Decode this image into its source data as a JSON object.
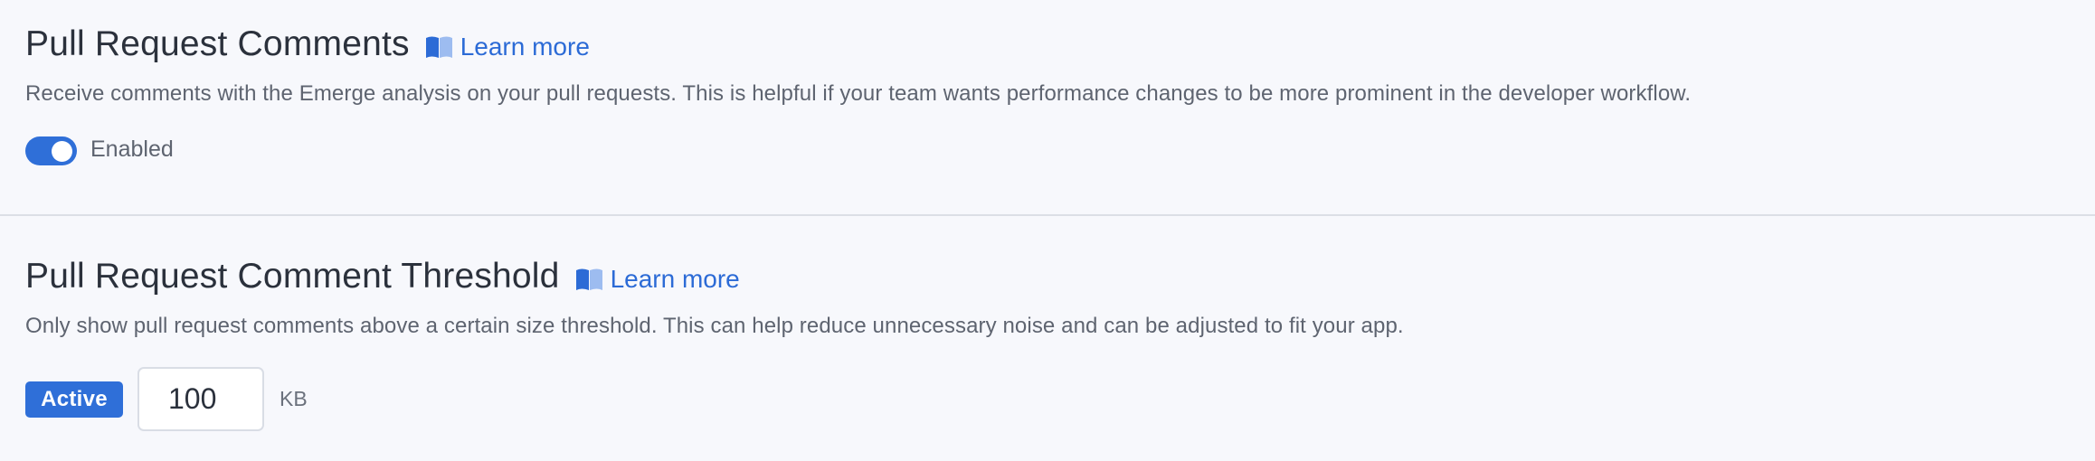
{
  "sections": [
    {
      "title": "Pull Request Comments",
      "learn_more": "Learn more",
      "description": "Receive comments with the Emerge analysis on your pull requests. This is helpful if your team wants performance changes to be more prominent in the developer workflow.",
      "toggle": {
        "label": "Enabled",
        "on": true
      }
    },
    {
      "title": "Pull Request Comment Threshold",
      "learn_more": "Learn more",
      "description": "Only show pull request comments above a certain size threshold. This can help reduce unnecessary noise and can be adjusted to fit your app.",
      "badge": "Active",
      "threshold_value": "100",
      "unit": "KB"
    }
  ],
  "icons": {
    "learn_more": "book-icon"
  },
  "colors": {
    "accent": "#2f6fd8",
    "link": "#2c6bd6",
    "background": "#f7f8fc",
    "divider": "#dcdfe6"
  }
}
